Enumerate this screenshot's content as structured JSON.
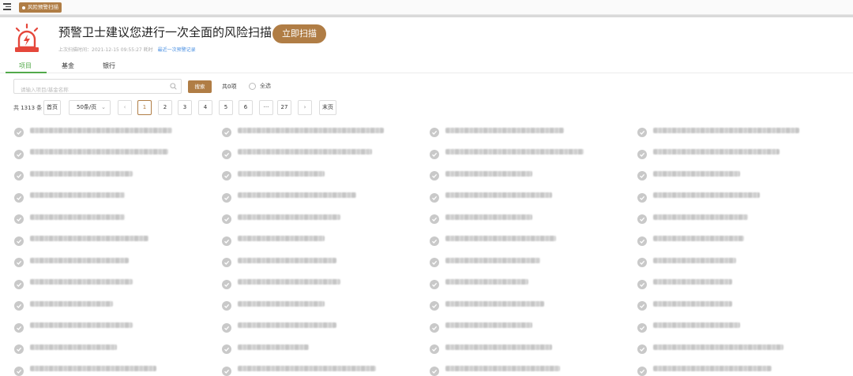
{
  "topbar": {
    "tab_label": "风险预警扫描"
  },
  "header": {
    "title": "预警卫士建议您进行一次全面的风险扫描",
    "scan_button": "立即扫描",
    "last_scan": "上次扫描时间：2021-12-15 09:55:27",
    "record_prefix": "耗时",
    "record_link": "最近一次预警记录"
  },
  "tabs": [
    "项目",
    "基金",
    "银行"
  ],
  "search": {
    "placeholder": "请输入项目/基金名称",
    "button": "搜索",
    "count_text": "共0项",
    "select_all": "全选"
  },
  "pagination": {
    "total": "共 1313 条",
    "first": "首页",
    "page_size": "50条/页",
    "prev": "‹",
    "pages": [
      "1",
      "2",
      "3",
      "4",
      "5",
      "6",
      "···",
      "27"
    ],
    "current": "1",
    "next": "›",
    "last": "末页"
  },
  "colors": {
    "accent": "#b07d45",
    "tab_active": "#52a94a",
    "link": "#4a90e2",
    "check": "#c9c9c9"
  },
  "icons": {
    "menu": "menu-icon",
    "alarm": "alarm-icon",
    "search": "search-icon",
    "check": "check-circle-icon"
  },
  "list": {
    "rows": 12,
    "columns": 4,
    "note": "item names are blurred in the source image"
  }
}
